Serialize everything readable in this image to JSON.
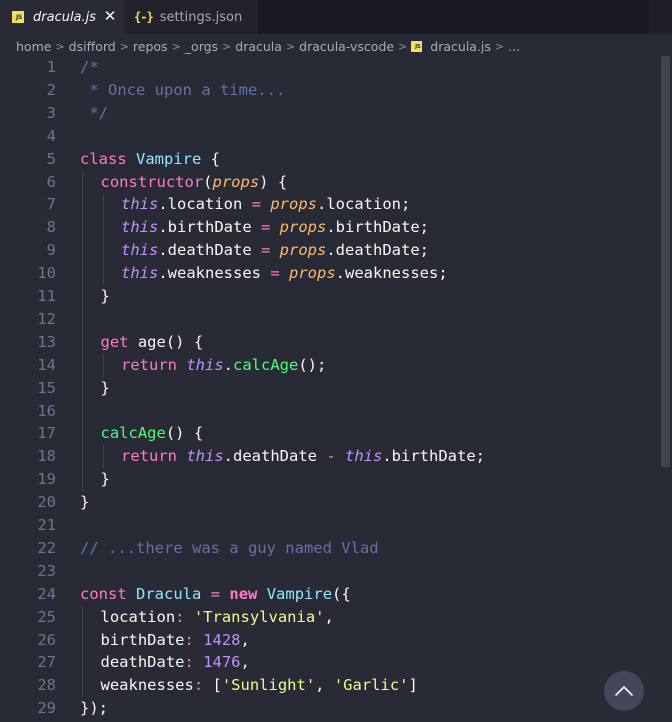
{
  "tabs": [
    {
      "label": "dracula.js",
      "icon": "javascript-file-icon",
      "active": true,
      "close_glyph": "✕"
    },
    {
      "label": "settings.json",
      "icon": "json-file-icon",
      "active": false
    }
  ],
  "icons": {
    "js_badge": "JS",
    "json_badge": "{-}"
  },
  "breadcrumb": {
    "items": [
      "home",
      "dsifford",
      "repos",
      "_orgs",
      "dracula",
      "dracula-vscode"
    ],
    "file": "dracula.js",
    "trailing": "...",
    "separator": ">"
  },
  "colors": {
    "background": "#282a36",
    "comment": "#6272a4",
    "keyword": "#ff79c6",
    "class_name": "#8be9fd",
    "function": "#50fa7b",
    "this": "#bd93f9",
    "parameter": "#ffb86c",
    "string": "#f1fa8c",
    "number": "#bd93f9",
    "foreground": "#f8f8f2",
    "line_number": "#6f7391"
  },
  "editor": {
    "line_numbers": [
      "1",
      "2",
      "3",
      "4",
      "5",
      "6",
      "7",
      "8",
      "9",
      "10",
      "11",
      "12",
      "13",
      "14",
      "15",
      "16",
      "17",
      "18",
      "19",
      "20",
      "21",
      "22",
      "23",
      "24",
      "25",
      "26",
      "27",
      "28",
      "29"
    ],
    "lines": [
      {
        "indent": 0,
        "tokens": [
          {
            "t": "/*",
            "c": "comment"
          }
        ]
      },
      {
        "indent": 0,
        "tokens": [
          {
            "t": " * Once upon a time...",
            "c": "comment"
          }
        ]
      },
      {
        "indent": 0,
        "tokens": [
          {
            "t": " */",
            "c": "comment"
          }
        ]
      },
      {
        "indent": 0,
        "tokens": []
      },
      {
        "indent": 0,
        "tokens": [
          {
            "t": "class",
            "c": "kw"
          },
          {
            "t": " ",
            "c": "plain"
          },
          {
            "t": "Vampire",
            "c": "cls"
          },
          {
            "t": " {",
            "c": "plain"
          }
        ]
      },
      {
        "indent": 1,
        "tokens": [
          {
            "t": "constructor",
            "c": "kw"
          },
          {
            "t": "(",
            "c": "plain"
          },
          {
            "t": "props",
            "c": "param"
          },
          {
            "t": ") {",
            "c": "plain"
          }
        ]
      },
      {
        "indent": 2,
        "tokens": [
          {
            "t": "this",
            "c": "this"
          },
          {
            "t": ".location ",
            "c": "plain"
          },
          {
            "t": "=",
            "c": "op"
          },
          {
            "t": " ",
            "c": "plain"
          },
          {
            "t": "props",
            "c": "param"
          },
          {
            "t": ".location;",
            "c": "plain"
          }
        ]
      },
      {
        "indent": 2,
        "tokens": [
          {
            "t": "this",
            "c": "this"
          },
          {
            "t": ".birthDate ",
            "c": "plain"
          },
          {
            "t": "=",
            "c": "op"
          },
          {
            "t": " ",
            "c": "plain"
          },
          {
            "t": "props",
            "c": "param"
          },
          {
            "t": ".birthDate;",
            "c": "plain"
          }
        ]
      },
      {
        "indent": 2,
        "tokens": [
          {
            "t": "this",
            "c": "this"
          },
          {
            "t": ".deathDate ",
            "c": "plain"
          },
          {
            "t": "=",
            "c": "op"
          },
          {
            "t": " ",
            "c": "plain"
          },
          {
            "t": "props",
            "c": "param"
          },
          {
            "t": ".deathDate;",
            "c": "plain"
          }
        ]
      },
      {
        "indent": 2,
        "tokens": [
          {
            "t": "this",
            "c": "this"
          },
          {
            "t": ".weaknesses ",
            "c": "plain"
          },
          {
            "t": "=",
            "c": "op"
          },
          {
            "t": " ",
            "c": "plain"
          },
          {
            "t": "props",
            "c": "param"
          },
          {
            "t": ".weaknesses;",
            "c": "plain"
          }
        ]
      },
      {
        "indent": 1,
        "tokens": [
          {
            "t": "}",
            "c": "plain"
          }
        ]
      },
      {
        "indent": 0,
        "tokens": []
      },
      {
        "indent": 1,
        "tokens": [
          {
            "t": "get",
            "c": "kw"
          },
          {
            "t": " age() {",
            "c": "plain"
          }
        ]
      },
      {
        "indent": 2,
        "tokens": [
          {
            "t": "return",
            "c": "kw"
          },
          {
            "t": " ",
            "c": "plain"
          },
          {
            "t": "this",
            "c": "this"
          },
          {
            "t": ".",
            "c": "plain"
          },
          {
            "t": "calcAge",
            "c": "fn"
          },
          {
            "t": "();",
            "c": "plain"
          }
        ]
      },
      {
        "indent": 1,
        "tokens": [
          {
            "t": "}",
            "c": "plain"
          }
        ]
      },
      {
        "indent": 0,
        "tokens": []
      },
      {
        "indent": 1,
        "tokens": [
          {
            "t": "calcAge",
            "c": "fn"
          },
          {
            "t": "() {",
            "c": "plain"
          }
        ]
      },
      {
        "indent": 2,
        "tokens": [
          {
            "t": "return",
            "c": "kw"
          },
          {
            "t": " ",
            "c": "plain"
          },
          {
            "t": "this",
            "c": "this"
          },
          {
            "t": ".deathDate ",
            "c": "plain"
          },
          {
            "t": "-",
            "c": "op"
          },
          {
            "t": " ",
            "c": "plain"
          },
          {
            "t": "this",
            "c": "this"
          },
          {
            "t": ".birthDate;",
            "c": "plain"
          }
        ]
      },
      {
        "indent": 1,
        "tokens": [
          {
            "t": "}",
            "c": "plain"
          }
        ]
      },
      {
        "indent": 0,
        "tokens": [
          {
            "t": "}",
            "c": "plain"
          }
        ]
      },
      {
        "indent": 0,
        "tokens": []
      },
      {
        "indent": 0,
        "tokens": [
          {
            "t": "// ...there was a guy named Vlad",
            "c": "comment"
          }
        ]
      },
      {
        "indent": 0,
        "tokens": []
      },
      {
        "indent": 0,
        "tokens": [
          {
            "t": "const",
            "c": "kw"
          },
          {
            "t": " ",
            "c": "plain"
          },
          {
            "t": "Dracula",
            "c": "cls"
          },
          {
            "t": " ",
            "c": "plain"
          },
          {
            "t": "=",
            "c": "op"
          },
          {
            "t": " ",
            "c": "plain"
          },
          {
            "t": "new",
            "c": "kwb"
          },
          {
            "t": " ",
            "c": "plain"
          },
          {
            "t": "Vampire",
            "c": "cls"
          },
          {
            "t": "({",
            "c": "plain"
          }
        ]
      },
      {
        "indent": 1,
        "tokens": [
          {
            "t": "location",
            "c": "plain"
          },
          {
            "t": ":",
            "c": "op"
          },
          {
            "t": " ",
            "c": "plain"
          },
          {
            "t": "'Transylvania'",
            "c": "str"
          },
          {
            "t": ",",
            "c": "plain"
          }
        ]
      },
      {
        "indent": 1,
        "tokens": [
          {
            "t": "birthDate",
            "c": "plain"
          },
          {
            "t": ":",
            "c": "op"
          },
          {
            "t": " ",
            "c": "plain"
          },
          {
            "t": "1428",
            "c": "num"
          },
          {
            "t": ",",
            "c": "plain"
          }
        ]
      },
      {
        "indent": 1,
        "tokens": [
          {
            "t": "deathDate",
            "c": "plain"
          },
          {
            "t": ":",
            "c": "op"
          },
          {
            "t": " ",
            "c": "plain"
          },
          {
            "t": "1476",
            "c": "num"
          },
          {
            "t": ",",
            "c": "plain"
          }
        ]
      },
      {
        "indent": 1,
        "tokens": [
          {
            "t": "weaknesses",
            "c": "plain"
          },
          {
            "t": ":",
            "c": "op"
          },
          {
            "t": " [",
            "c": "plain"
          },
          {
            "t": "'Sunlight'",
            "c": "str"
          },
          {
            "t": ", ",
            "c": "plain"
          },
          {
            "t": "'Garlic'",
            "c": "str"
          },
          {
            "t": "]",
            "c": "plain"
          }
        ]
      },
      {
        "indent": 0,
        "tokens": [
          {
            "t": "});",
            "c": "plain"
          }
        ]
      }
    ]
  },
  "scroll_to_top": {
    "icon": "chevron-up-icon"
  }
}
